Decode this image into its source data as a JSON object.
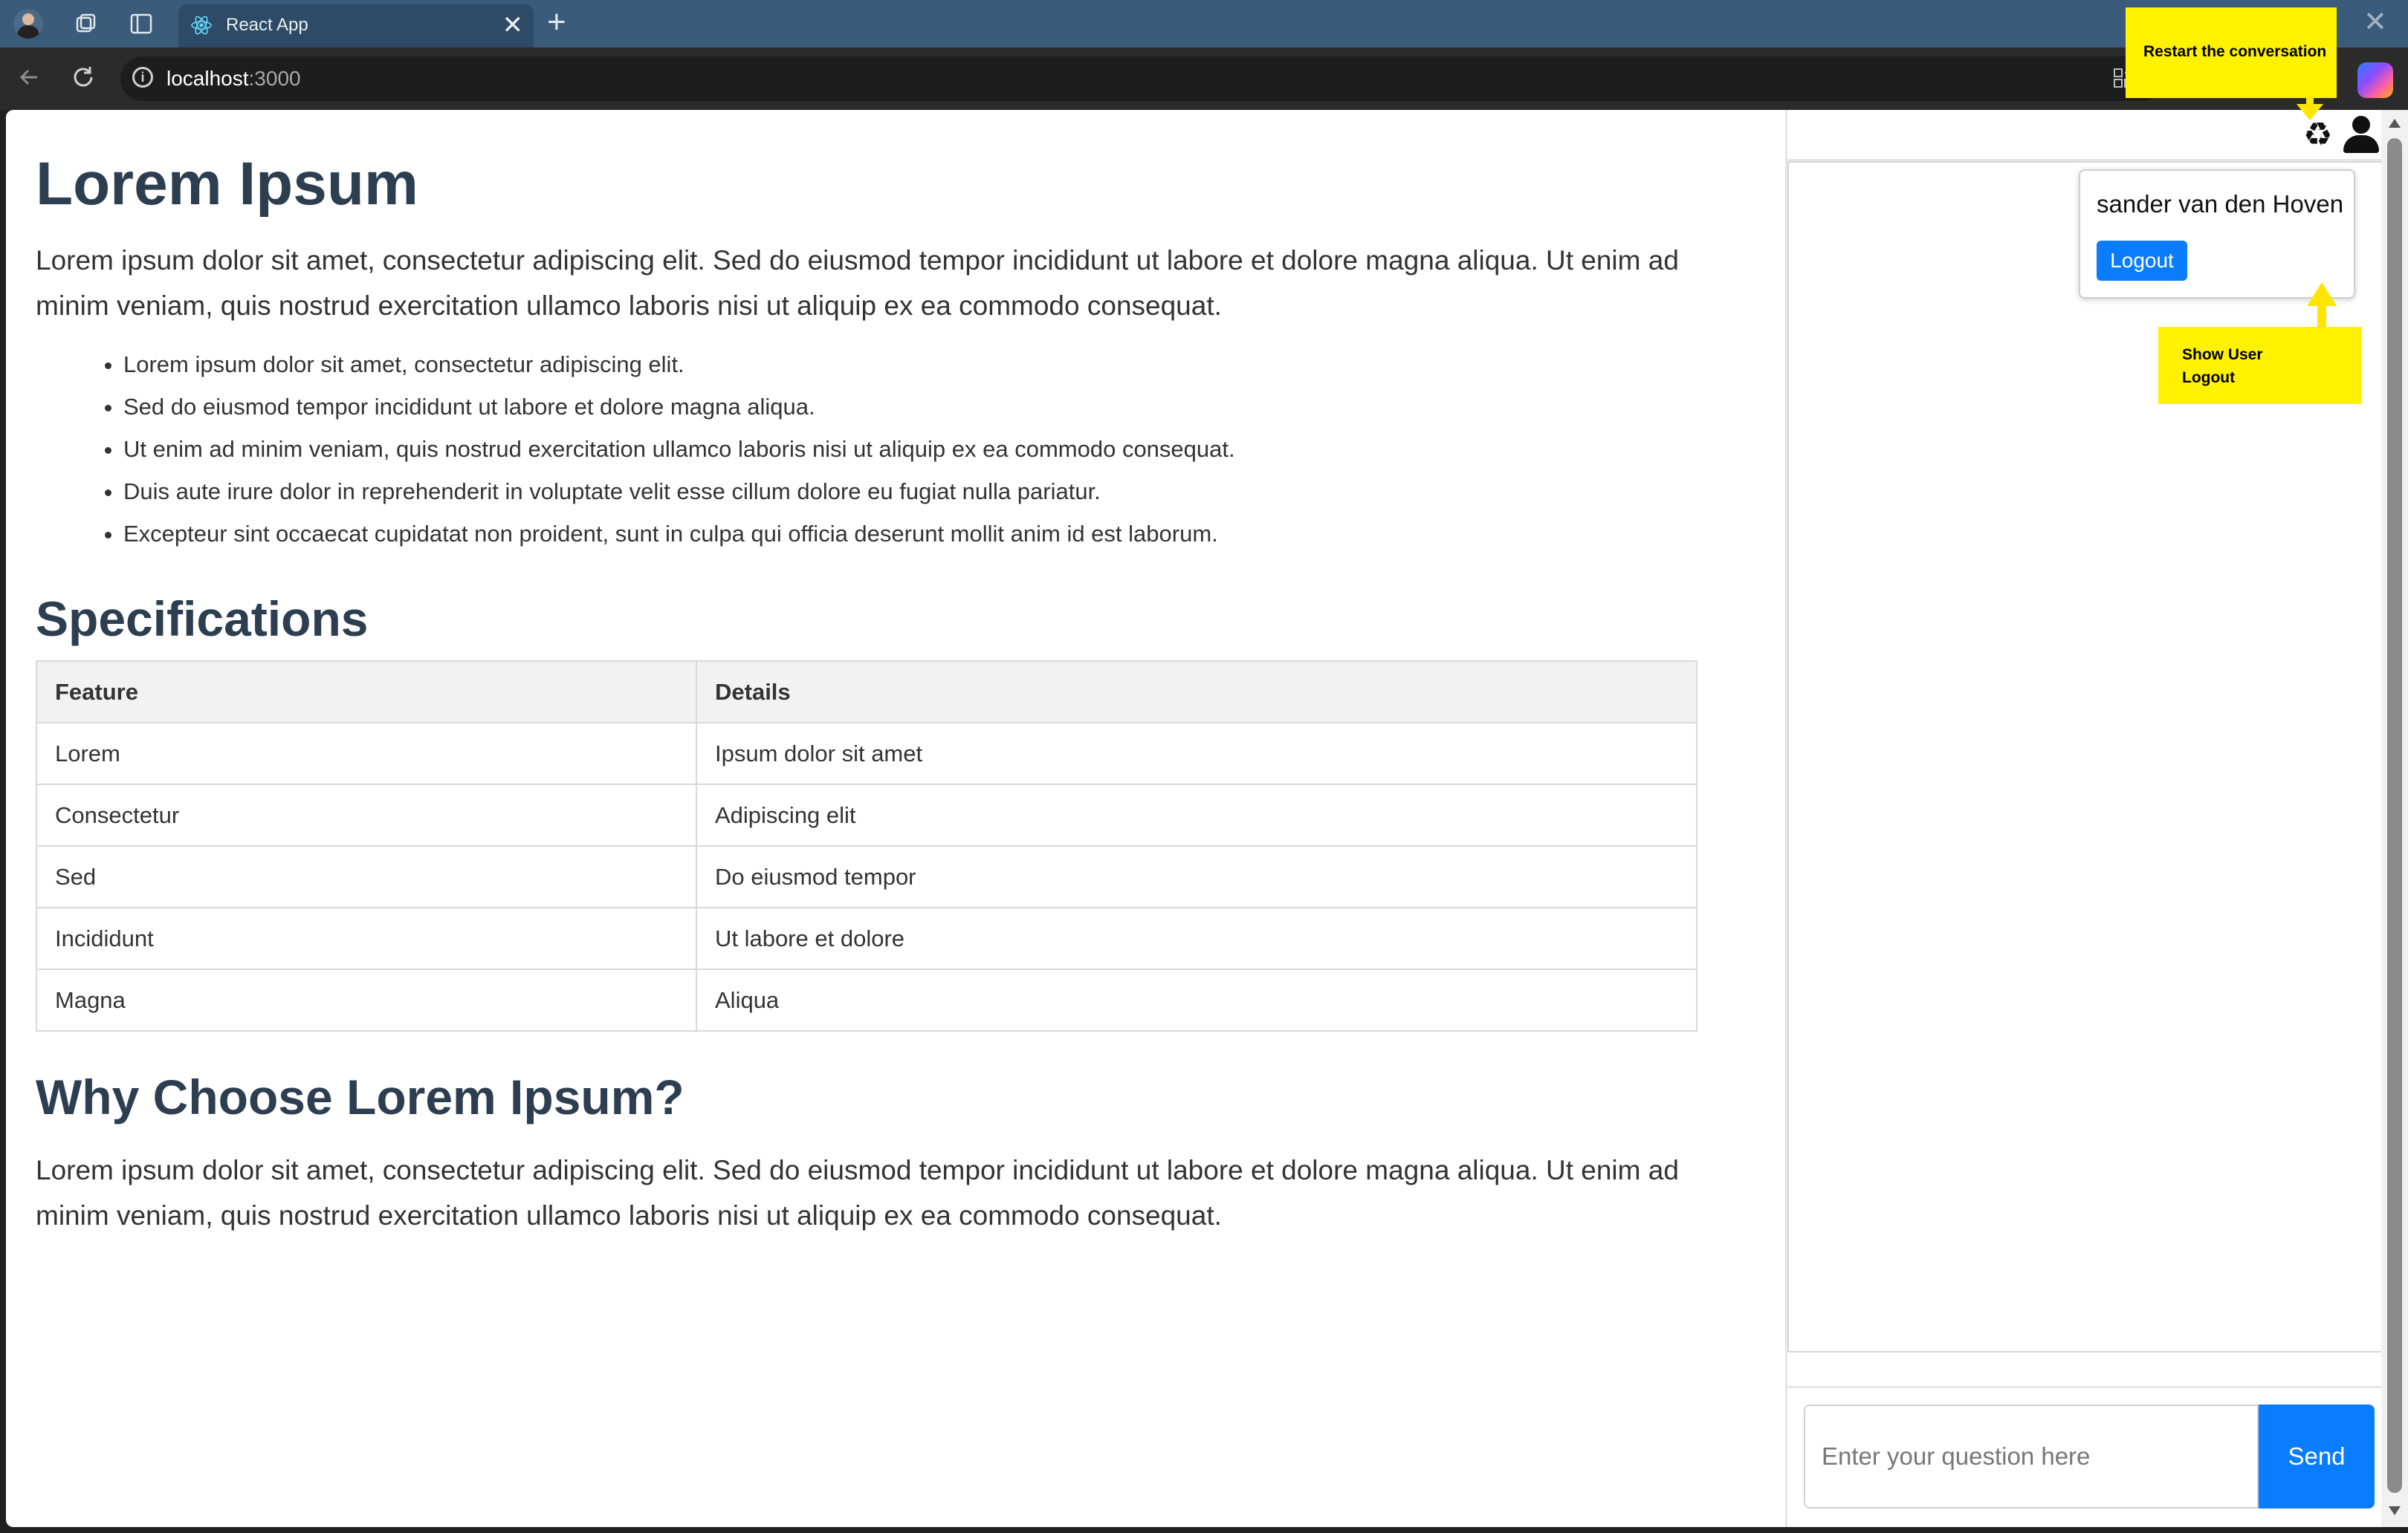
{
  "browser": {
    "tab_title": "React App",
    "tab_close": "✕",
    "new_tab": "+",
    "window_close": "✕",
    "url_host": "localhost",
    "url_port": ":3000",
    "icons": [
      "profile-avatar",
      "workspaces-icon",
      "vertical-tabs-icon",
      "react-icon",
      "back-icon",
      "reload-icon",
      "site-info-icon",
      "app-available-icon",
      "copilot-icon"
    ]
  },
  "content": {
    "title": "Lorem Ipsum",
    "intro": "Lorem ipsum dolor sit amet, consectetur adipiscing elit. Sed do eiusmod tempor incididunt ut labore et dolore magna aliqua. Ut enim ad minim veniam, quis nostrud exercitation ullamco laboris nisi ut aliquip ex ea commodo consequat.",
    "bullets": [
      "Lorem ipsum dolor sit amet, consectetur adipiscing elit.",
      "Sed do eiusmod tempor incididunt ut labore et dolore magna aliqua.",
      "Ut enim ad minim veniam, quis nostrud exercitation ullamco laboris nisi ut aliquip ex ea commodo consequat.",
      "Duis aute irure dolor in reprehenderit in voluptate velit esse cillum dolore eu fugiat nulla pariatur.",
      "Excepteur sint occaecat cupidatat non proident, sunt in culpa qui officia deserunt mollit anim id est laborum."
    ],
    "spec_heading": "Specifications",
    "table": {
      "headers": [
        "Feature",
        "Details"
      ],
      "rows": [
        [
          "Lorem",
          "Ipsum dolor sit amet"
        ],
        [
          "Consectetur",
          "Adipiscing elit"
        ],
        [
          "Sed",
          "Do eiusmod tempor"
        ],
        [
          "Incididunt",
          "Ut labore et dolore"
        ],
        [
          "Magna",
          "Aliqua"
        ]
      ]
    },
    "why_heading": "Why Choose Lorem Ipsum?",
    "why_text": "Lorem ipsum dolor sit amet, consectetur adipiscing elit. Sed do eiusmod tempor incididunt ut labore et dolore magna aliqua. Ut enim ad minim veniam, quis nostrud exercitation ullamco laboris nisi ut aliquip ex ea commodo consequat."
  },
  "chat": {
    "recycle_glyph": "♻",
    "user_name": "sander van den Hoven",
    "logout_label": "Logout",
    "input_placeholder": "Enter your question here",
    "send_label": "Send"
  },
  "annotations": {
    "restart": "Restart the conversation",
    "show_user": "Show User\nLogout"
  },
  "colors": {
    "heading": "#2c3e50",
    "accent_blue": "#0a7cff",
    "annotation_yellow": "#fff200",
    "tabbar": "#3b5b7a"
  }
}
